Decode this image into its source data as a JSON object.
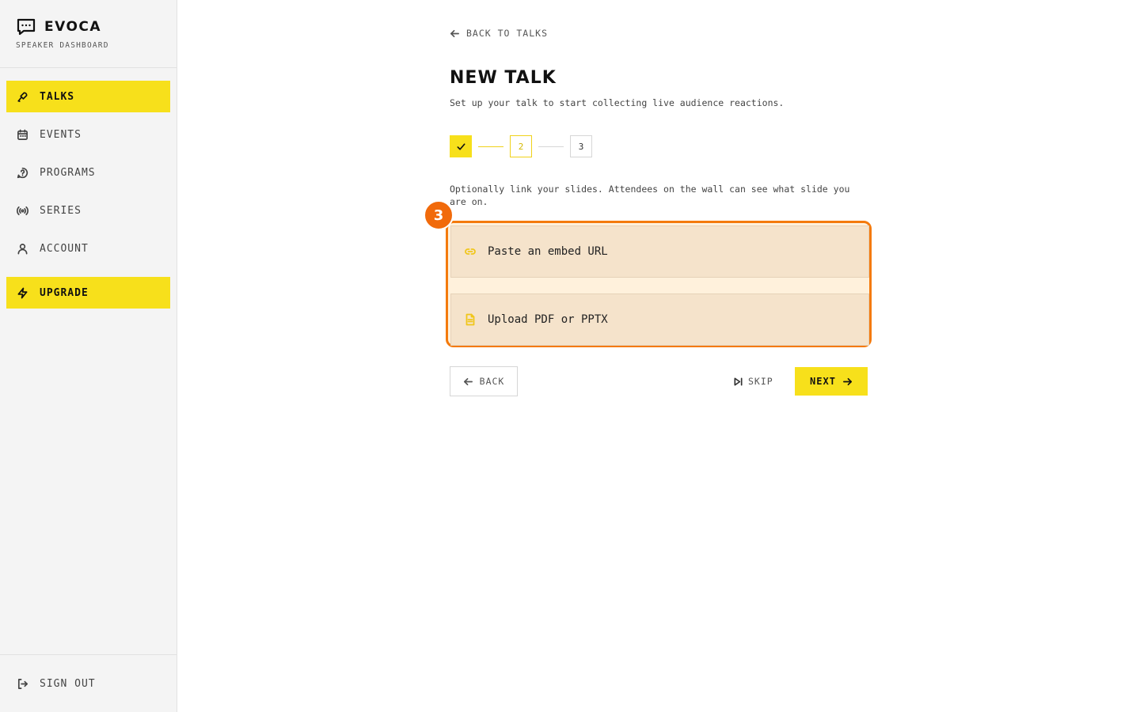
{
  "brand": {
    "name": "EVOCA",
    "subtitle": "SPEAKER DASHBOARD",
    "icon": "chat-bubble-icon"
  },
  "sidebar": {
    "items": [
      {
        "label": "TALKS",
        "icon": "microphone-icon",
        "active": true
      },
      {
        "label": "EVENTS",
        "icon": "calendar-icon",
        "active": false
      },
      {
        "label": "PROGRAMS",
        "icon": "help-circle-icon",
        "active": false
      },
      {
        "label": "SERIES",
        "icon": "broadcast-icon",
        "active": false
      },
      {
        "label": "ACCOUNT",
        "icon": "user-icon",
        "active": false
      }
    ],
    "upgrade": {
      "label": "UPGRADE",
      "icon": "lightning-icon"
    },
    "signout": {
      "label": "SIGN OUT",
      "icon": "sign-out-icon"
    }
  },
  "main": {
    "back_link": "BACK TO TALKS",
    "title": "NEW TALK",
    "subtitle": "Set up your talk to start collecting live audience reactions.",
    "stepper": {
      "steps": [
        {
          "label": "",
          "state": "done"
        },
        {
          "label": "2",
          "state": "current"
        },
        {
          "label": "3",
          "state": "todo"
        }
      ]
    },
    "instruction": "Optionally link your slides. Attendees on the wall can see what slide you are on.",
    "options": [
      {
        "label": "Paste an embed URL",
        "icon": "link-icon"
      },
      {
        "label": "Upload PDF or PPTX",
        "icon": "document-icon"
      }
    ],
    "highlight_badge": "3",
    "actions": {
      "back": "BACK",
      "skip": "SKIP",
      "next": "NEXT"
    }
  },
  "colors": {
    "accent": "#f7e01b",
    "highlight": "#f47a0c",
    "sidebar_bg": "#f4f4f4"
  }
}
